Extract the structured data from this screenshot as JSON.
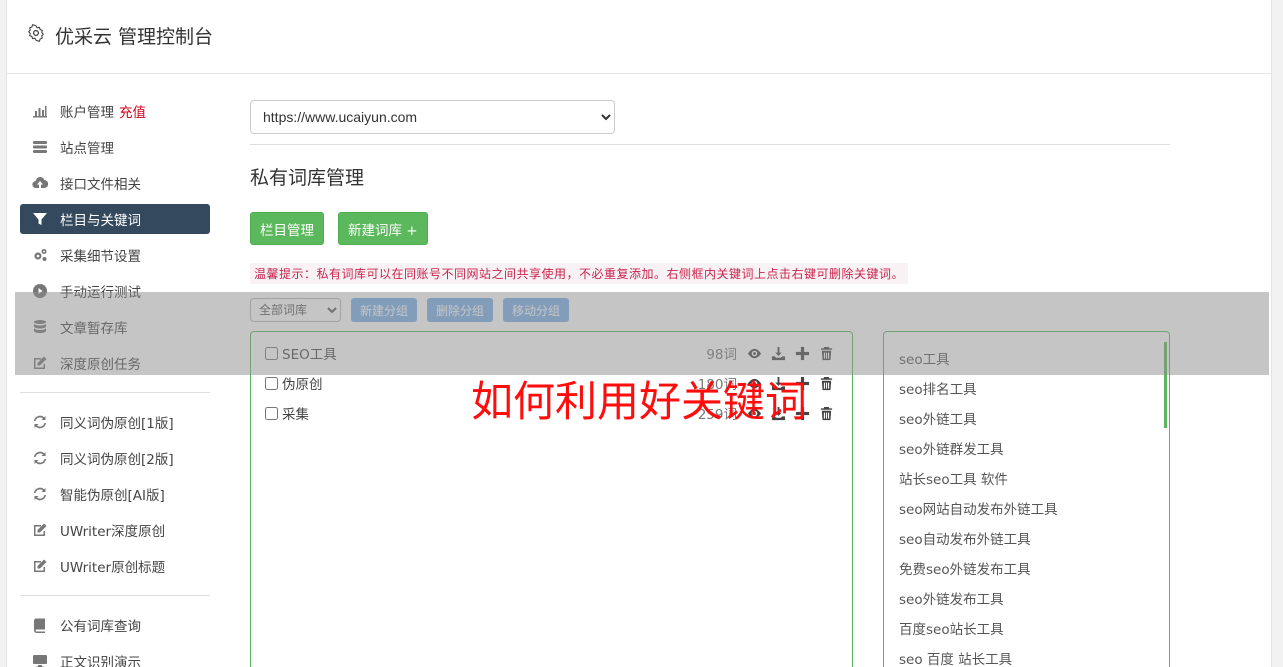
{
  "header": {
    "title": "优采云 管理控制台"
  },
  "sidebar": {
    "group1": [
      {
        "label": "账户管理",
        "badge": "充值",
        "icon": "bar-chart-icon"
      },
      {
        "label": "站点管理",
        "icon": "server-icon"
      },
      {
        "label": "接口文件相关",
        "icon": "cloud-upload-icon"
      },
      {
        "label": "栏目与关键词",
        "icon": "filter-icon",
        "active": true
      },
      {
        "label": "采集细节设置",
        "icon": "cogs-icon"
      },
      {
        "label": "手动运行测试",
        "icon": "play-circle-icon"
      },
      {
        "label": "文章暂存库",
        "icon": "database-icon"
      },
      {
        "label": "深度原创任务",
        "icon": "edit-icon"
      }
    ],
    "group2": [
      {
        "label": "同义词伪原创[1版]",
        "icon": "refresh-icon"
      },
      {
        "label": "同义词伪原创[2版]",
        "icon": "refresh-icon"
      },
      {
        "label": "智能伪原创[AI版]",
        "icon": "refresh-icon"
      },
      {
        "label": "UWriter深度原创",
        "icon": "edit-icon"
      },
      {
        "label": "UWriter原创标题",
        "icon": "edit-icon"
      }
    ],
    "group3": [
      {
        "label": "公有词库查询",
        "icon": "book-icon"
      },
      {
        "label": "正文识别演示",
        "icon": "monitor-icon"
      }
    ]
  },
  "main": {
    "site_select": "https://www.ucaiyun.com",
    "section_title": "私有词库管理",
    "buttons": {
      "column_manage": "栏目管理",
      "new_library": "新建词库 +"
    },
    "tip": "温馨提示：私有词库可以在同账号不同网站之间共享使用，不必重复添加。右侧框内关键词上点击右键可删除关键词。",
    "toolbar": {
      "filter_select": "全部词库",
      "new_group": "新建分组",
      "delete_group": "删除分组",
      "move_group": "移动分组"
    },
    "libraries": [
      {
        "name": "SEO工具",
        "count": "98词"
      },
      {
        "name": "伪原创",
        "count": "180词"
      },
      {
        "name": "采集",
        "count": "259词"
      }
    ],
    "keywords": [
      "seo工具",
      "seo排名工具",
      "seo外链工具",
      "seo外链群发工具",
      "站长seo工具 软件",
      "seo网站自动发布外链工具",
      "seo自动发布外链工具",
      "免费seo外链发布工具",
      "seo外链发布工具",
      "百度seo站长工具",
      "seo 百度 站长工具"
    ]
  },
  "overlay": {
    "text": "如何利用好关键词"
  }
}
